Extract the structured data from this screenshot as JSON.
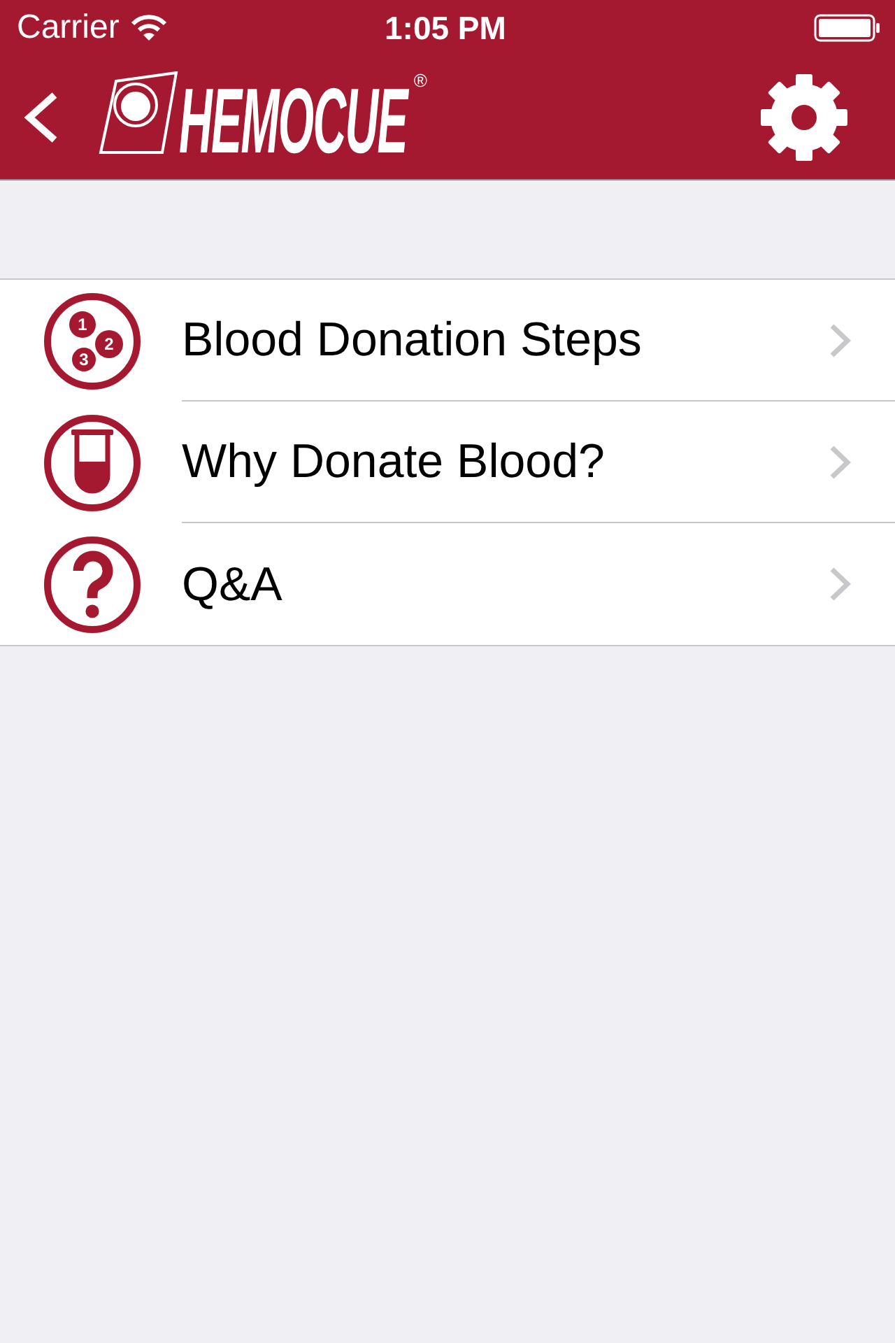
{
  "status_bar": {
    "carrier": "Carrier",
    "time": "1:05 PM"
  },
  "nav_bar": {
    "logo_text": "HEMOCUE",
    "logo_mark": "®"
  },
  "menu": [
    {
      "kind": "steps",
      "label": "Blood Donation Steps",
      "icon_digits": [
        "1",
        "2",
        "3"
      ]
    },
    {
      "kind": "tube",
      "label": "Why Donate Blood?"
    },
    {
      "kind": "question",
      "label": "Q&A"
    }
  ]
}
